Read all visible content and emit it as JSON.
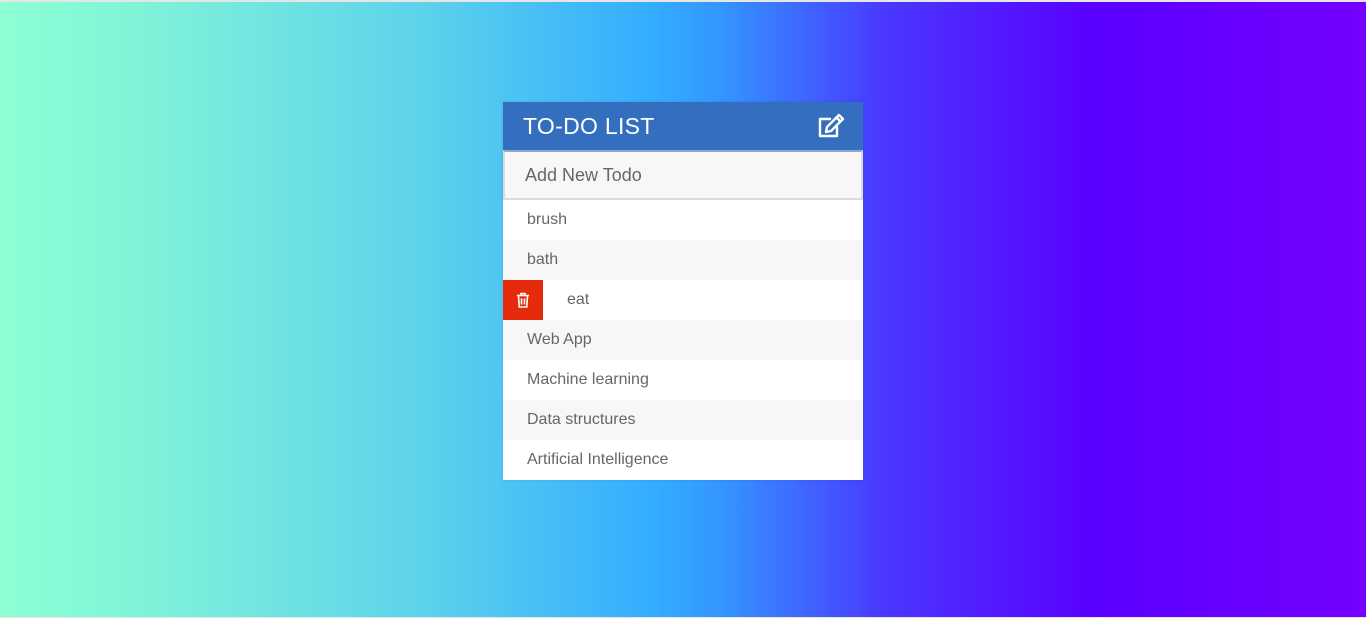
{
  "app": {
    "title": "TO-DO LIST",
    "header_icon": "edit-icon"
  },
  "input": {
    "placeholder": "Add New Todo",
    "value": ""
  },
  "todos": [
    {
      "label": "brush",
      "hovered": false
    },
    {
      "label": "bath",
      "hovered": false
    },
    {
      "label": "eat",
      "hovered": true
    },
    {
      "label": "Web App",
      "hovered": false
    },
    {
      "label": "Machine learning",
      "hovered": false
    },
    {
      "label": "Data structures",
      "hovered": false
    },
    {
      "label": "Artificial Intelligence",
      "hovered": false
    }
  ],
  "colors": {
    "header": "#346fbf",
    "delete": "#e62b0c",
    "text": "#666666",
    "row_alt": "#f7f7f7"
  },
  "icons": {
    "delete": "trash-icon"
  }
}
